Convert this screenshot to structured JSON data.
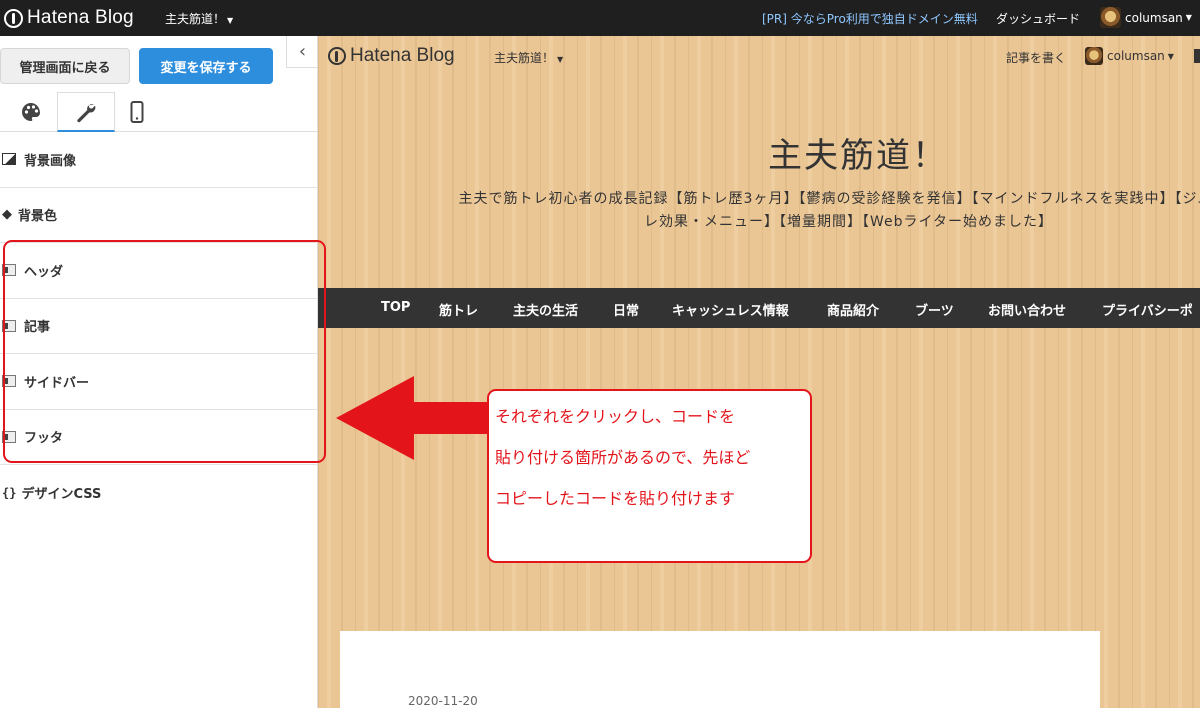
{
  "topbar": {
    "logo": "Hatena Blog",
    "blog_name": "主夫筋道！",
    "pr_link": "[PR] 今ならPro利用で独自ドメイン無料",
    "dashboard": "ダッシュボード",
    "username": "columsan"
  },
  "panel": {
    "back_button": "管理画面に戻る",
    "save_button": "変更を保存する",
    "collapse_icon": "chevron-left",
    "tabs": [
      {
        "icon": "palette"
      },
      {
        "icon": "wrench",
        "active": true
      },
      {
        "icon": "smartphone"
      }
    ],
    "items": [
      {
        "label": "背景画像",
        "icon": "image"
      },
      {
        "label": "背景色",
        "icon": "paint-bucket"
      },
      {
        "label": "ヘッダ",
        "icon": "layout-header"
      },
      {
        "label": "記事",
        "icon": "layout-content"
      },
      {
        "label": "サイドバー",
        "icon": "layout-sidebar"
      },
      {
        "label": "フッタ",
        "icon": "layout-footer"
      },
      {
        "label": "デザインCSS",
        "icon": "css-braces"
      }
    ]
  },
  "preview": {
    "logo": "Hatena Blog",
    "blog_name": "主夫筋道！",
    "write_link": "記事を書く",
    "username": "columsan",
    "title": "主夫筋道！",
    "description_line1": "主夫で筋トレ初心者の成長記録【筋トレ歴3ヶ月】【鬱病の受診経験を発信】【マインドフルネスを実践中】【ジムで",
    "description_line2": "レ効果・メニュー】【増量期間】【Webライター始めました】",
    "nav": [
      "TOP",
      "筋トレ",
      "主夫の生活",
      "日常",
      "キャッシュレス情報",
      "商品紹介",
      "ブーツ",
      "お問い合わせ",
      "プライバシーポ"
    ],
    "date": "2020-11-20"
  },
  "annotation": {
    "lines": [
      "それぞれをクリックし、コードを",
      "貼り付ける箇所があるので、先ほど",
      "コピーしたコードを貼り付けます"
    ],
    "color": "#e3151b"
  },
  "colors": {
    "accent": "#2e8ede",
    "topbar": "#1f1f1f",
    "nav": "#333333",
    "wood": "#ebc695"
  }
}
